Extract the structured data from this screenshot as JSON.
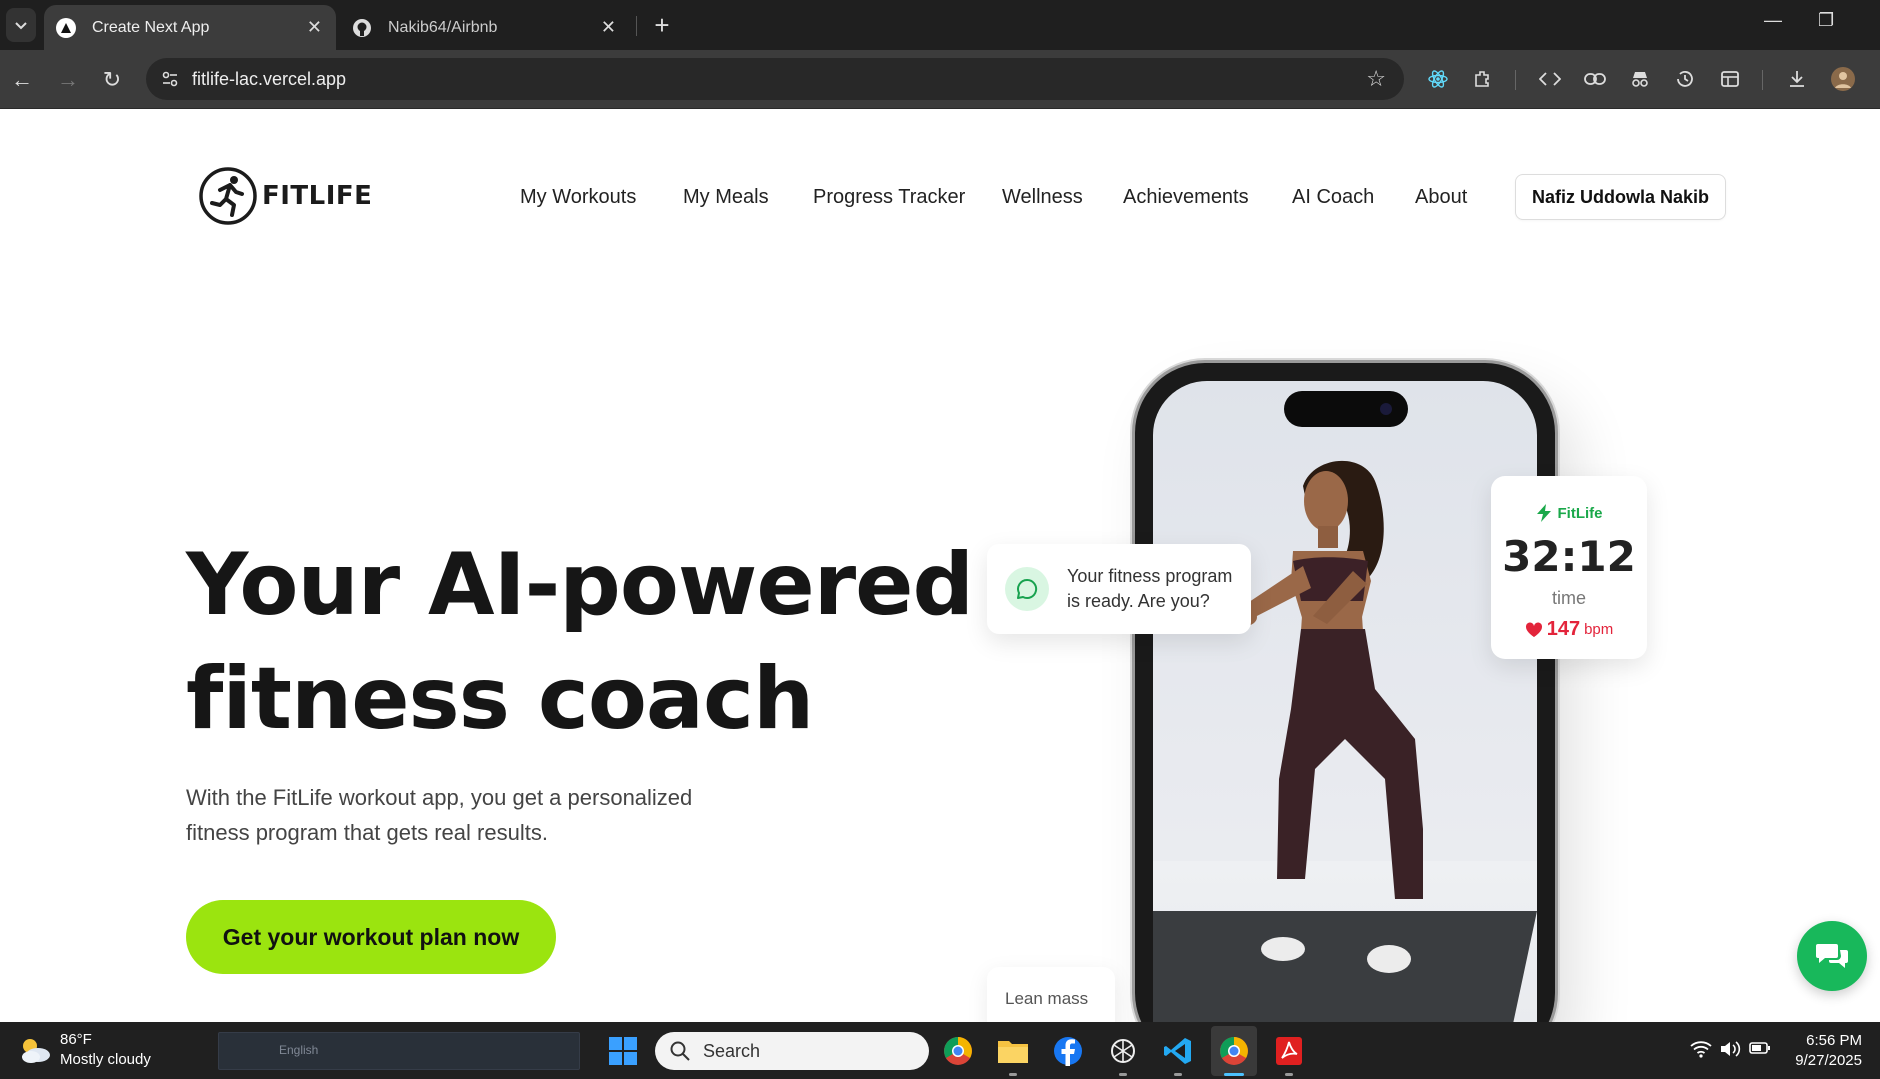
{
  "browser": {
    "tabs": [
      {
        "title": "Create Next App",
        "active": true
      },
      {
        "title": "Nakib64/Airbnb",
        "active": false
      }
    ],
    "url": "fitlife-lac.vercel.app"
  },
  "site": {
    "brand": "FITLIFE",
    "nav": [
      "My Workouts",
      "My Meals",
      "Progress Tracker",
      "Wellness",
      "Achievements",
      "AI Coach",
      "About"
    ],
    "user": "Nafiz Uddowla Nakib"
  },
  "hero": {
    "headline_line1": "Your AI-powered",
    "headline_line2": "fitness coach",
    "subtext": "With the FitLife workout app, you get a personalized fitness program that gets real results.",
    "cta": "Get your workout plan now"
  },
  "cards": {
    "message": "Your fitness program is ready. Are you?",
    "stats_brand": "FitLife",
    "stats_time": "32:12",
    "stats_time_label": "time",
    "stats_bpm": "147",
    "stats_bpm_unit": "bpm",
    "lean": "Lean mass"
  },
  "colors": {
    "accent": "#9be40f",
    "brand_green": "#1aa84a",
    "chat_fab": "#18b85b",
    "heart": "#e3243b"
  },
  "taskbar": {
    "temp": "86°F",
    "condition": "Mostly cloudy",
    "tray_text": "English",
    "search": "Search",
    "time": "6:56 PM",
    "date": "9/27/2025"
  }
}
